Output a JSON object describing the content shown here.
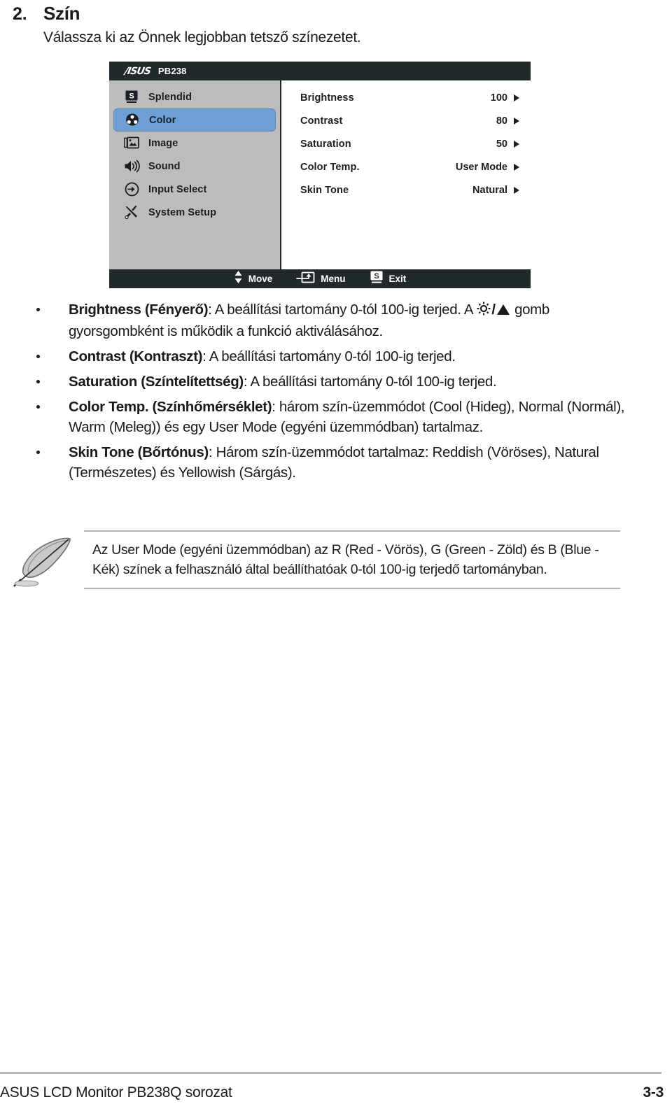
{
  "section": {
    "number": "2.",
    "title": "Szín",
    "subtitle": "Válassza ki az Önnek legjobban tetsző színezetet."
  },
  "osd": {
    "brand": "/ISUS",
    "model": "PB238",
    "sidebar": [
      {
        "label": "Splendid",
        "icon": "splendid-s-icon",
        "selected": false
      },
      {
        "label": "Color",
        "icon": "color-palette-icon",
        "selected": true
      },
      {
        "label": "Image",
        "icon": "image-icon",
        "selected": false
      },
      {
        "label": "Sound",
        "icon": "speaker-icon",
        "selected": false
      },
      {
        "label": "Input Select",
        "icon": "input-arrow-icon",
        "selected": false
      },
      {
        "label": "System Setup",
        "icon": "tools-icon",
        "selected": false
      }
    ],
    "options": [
      {
        "label": "Brightness",
        "value": "100"
      },
      {
        "label": "Contrast",
        "value": "80"
      },
      {
        "label": "Saturation",
        "value": "50"
      },
      {
        "label": "Color Temp.",
        "value": "User Mode"
      },
      {
        "label": "Skin Tone",
        "value": "Natural"
      }
    ],
    "footer": [
      {
        "label": "Move",
        "icon": "up-down-arrows-icon"
      },
      {
        "label": "Menu",
        "icon": "menu-enter-icon"
      },
      {
        "label": "Exit",
        "icon": "splendid-s-icon"
      }
    ],
    "colors": {
      "titlebar": "#22292c",
      "sidebar": "#bcbcbc",
      "highlight": "#6d9fd4",
      "panel": "#ffffff"
    }
  },
  "bullets": [
    {
      "term": "Brightness (Fényerő)",
      "text_before_icons": ": A beállítási tartomány 0-tól 100-ig terjed. A ",
      "text_after_icons": " gomb gyorsgombként is működik a funkció aktiválásához.",
      "has_icons": true,
      "icon_names": [
        "brightness-sun-icon",
        "up-triangle-icon"
      ],
      "separator": "/"
    },
    {
      "term": "Contrast (Kontraszt)",
      "text": ": A beállítási tartomány 0-tól 100-ig terjed.",
      "has_icons": false
    },
    {
      "term": "Saturation (Színtelítettség)",
      "text": ": A beállítási tartomány 0-tól 100-ig terjed.",
      "has_icons": false
    },
    {
      "term": "Color Temp. (Színhőmérséklet)",
      "text": ": három szín-üzemmódot (Cool (Hideg), Normal (Normál), Warm (Meleg)) és egy User Mode (egyéni üzemmódban) tartalmaz.",
      "has_icons": false
    },
    {
      "term": "Skin Tone (Bőrtónus)",
      "text": ": Három szín-üzemmódot tartalmaz: Reddish (Vöröses), Natural (Természetes) és Yellowish (Sárgás).",
      "has_icons": false
    }
  ],
  "note": {
    "icon": "feather-pen-icon",
    "text": "Az User Mode (egyéni üzemmódban) az R (Red - Vörös), G (Green - Zöld) és B (Blue - Kék) színek a felhasználó által beállíthatóak 0-tól 100-ig terjedő tartományban."
  },
  "page_footer": {
    "left": "ASUS LCD Monitor PB238Q sorozat",
    "right": "3-3"
  }
}
